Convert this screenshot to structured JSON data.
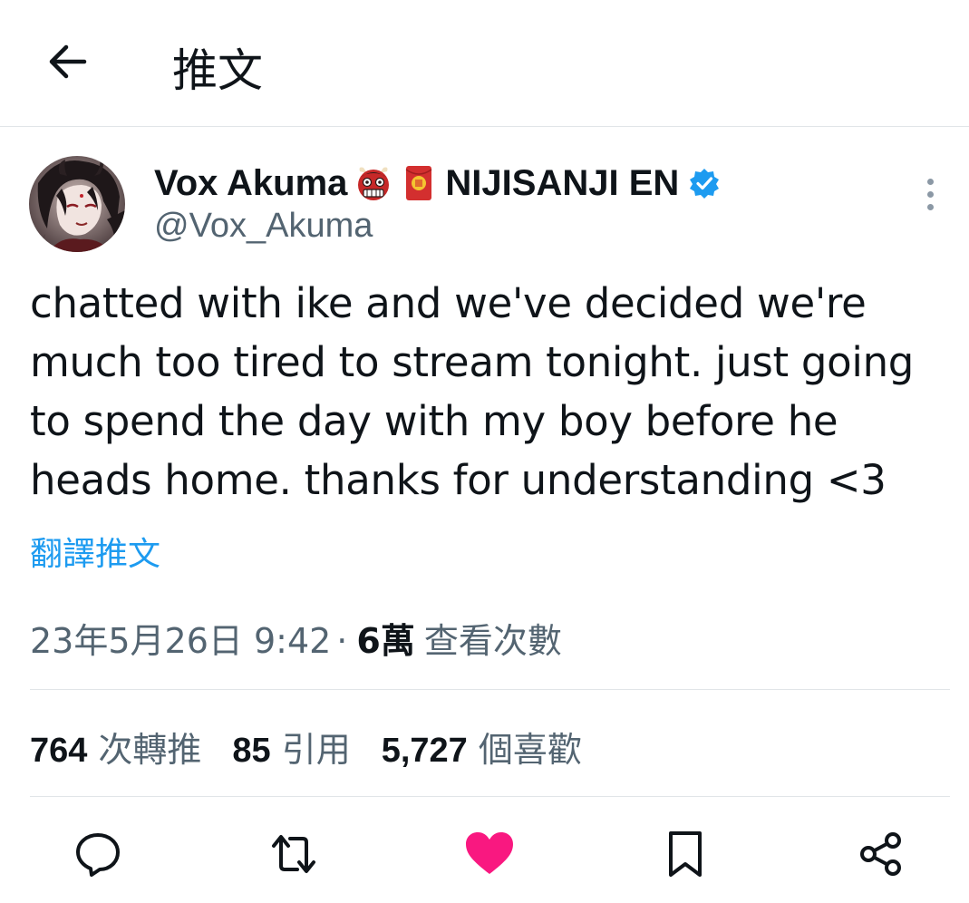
{
  "header": {
    "title": "推文",
    "back_icon": "arrow-left-icon"
  },
  "author": {
    "display_name": "Vox Akuma",
    "display_name_suffix": "NIJISANJI EN",
    "emojis": [
      "oni-mask-emoji",
      "red-envelope-emoji"
    ],
    "handle": "@Vox_Akuma",
    "verified_icon": "verified-badge-icon",
    "verified_color": "#1d9bf0"
  },
  "tweet": {
    "text": "chatted with ike and we've decided we're much too tired to stream tonight. just going to spend the day with my boy before he heads home. thanks for understanding <3",
    "translate_label": "翻譯推文"
  },
  "meta": {
    "timestamp": "23年5月26日 9:42",
    "separator": "·",
    "views_count": "6萬",
    "views_label": "查看次數"
  },
  "stats": {
    "retweets_count": "764",
    "retweets_label": "次轉推",
    "quotes_count": "85",
    "quotes_label": "引用",
    "likes_count": "5,727",
    "likes_label": "個喜歡"
  },
  "actions": {
    "reply_icon": "reply-icon",
    "retweet_icon": "retweet-icon",
    "like_icon": "heart-filled-icon",
    "like_color": "#f91880",
    "bookmark_icon": "bookmark-icon",
    "share_icon": "share-icon"
  },
  "colors": {
    "text_primary": "#0f1419",
    "text_secondary": "#536471",
    "link": "#1d9bf0",
    "divider": "#e1e5e8"
  }
}
